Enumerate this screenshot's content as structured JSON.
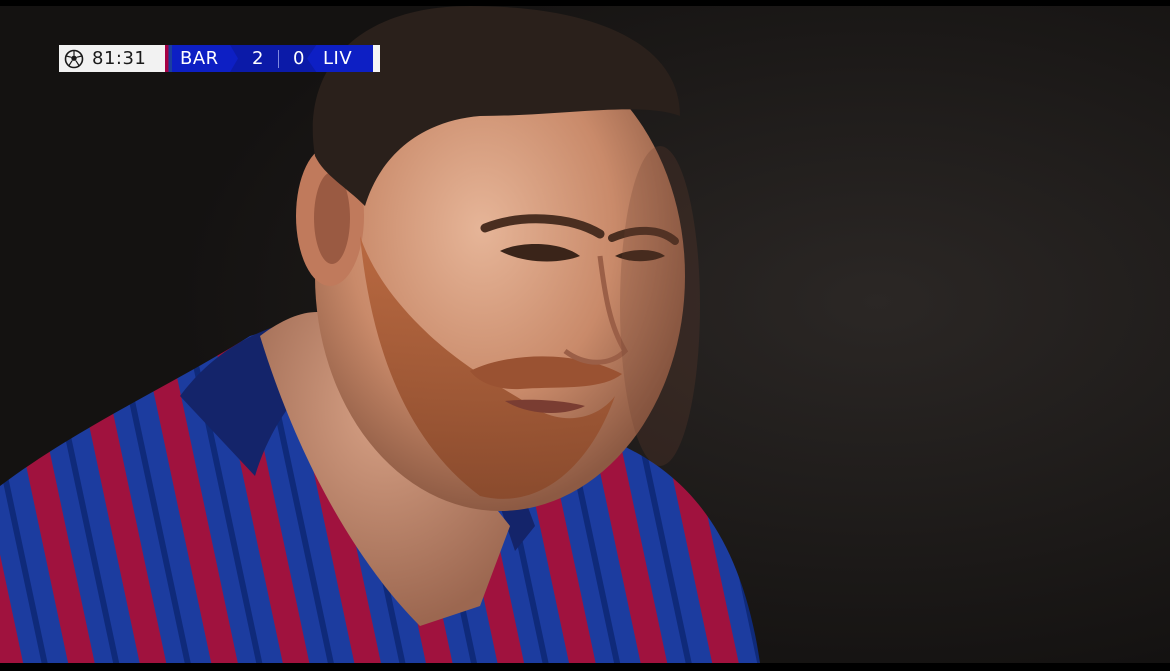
{
  "scorebug": {
    "clock": "81:31",
    "competition_icon": "champions-league-ball-icon",
    "home_team": "BAR",
    "home_score": "2",
    "away_score": "0",
    "away_team": "LIV",
    "colors": {
      "clock_bg": "#f2f2f2",
      "main_bg": "#0b1aa8",
      "home_accent_red": "#a50044",
      "home_accent_blue": "#1b3f9c",
      "away_accent": "#f5f5f5"
    }
  },
  "scene": {
    "subject": "player-close-up",
    "jersey_colors": [
      "#1a3fa8",
      "#a3103f"
    ],
    "background_color": "#1a1716"
  }
}
